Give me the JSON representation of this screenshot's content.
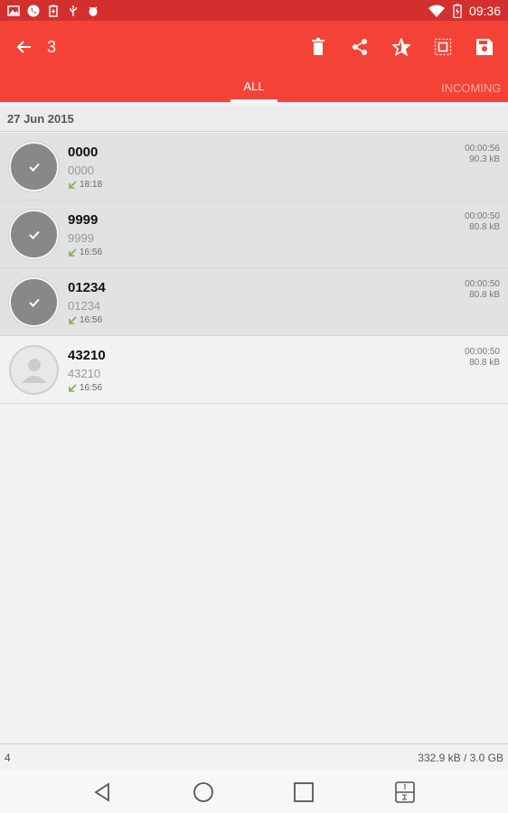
{
  "status_bar": {
    "clock": "09:36",
    "icons_left": [
      "image-icon",
      "phone-icon",
      "battery-saver-icon",
      "usb-icon",
      "android-debug-icon"
    ],
    "icons_right": [
      "wifi-icon",
      "battery-icon"
    ]
  },
  "toolbar": {
    "selected_count": "3",
    "back_icon": "arrow-left-icon",
    "actions": [
      "delete-icon",
      "share-icon",
      "favorite-icon",
      "select-all-icon",
      "save-icon"
    ]
  },
  "tabs": [
    {
      "label": "ALL",
      "active": true
    },
    {
      "label": "INCOMING",
      "active": false
    }
  ],
  "date_group": "27 Jun 2015",
  "recordings": [
    {
      "name": "0000",
      "number": "0000",
      "time": "18:18",
      "duration": "00:00:56",
      "size": "90.3 kB",
      "selected": true
    },
    {
      "name": "9999",
      "number": "9999",
      "time": "16:56",
      "duration": "00:00:50",
      "size": "80.8 kB",
      "selected": true
    },
    {
      "name": "01234",
      "number": "01234",
      "time": "16:56",
      "duration": "00:00:50",
      "size": "80.8 kB",
      "selected": true
    },
    {
      "name": "43210",
      "number": "43210",
      "time": "16:56",
      "duration": "00:00:50",
      "size": "80.8 kB",
      "selected": false
    }
  ],
  "footer": {
    "count": "4",
    "storage": "332.9 kB / 3.0 GB"
  },
  "nav": [
    "back-icon",
    "home-icon",
    "recents-icon",
    "split-screen-icon"
  ],
  "colors": {
    "status_bar": "#d32f2f",
    "toolbar": "#f44336",
    "incoming_arrow": "#7cb342"
  }
}
